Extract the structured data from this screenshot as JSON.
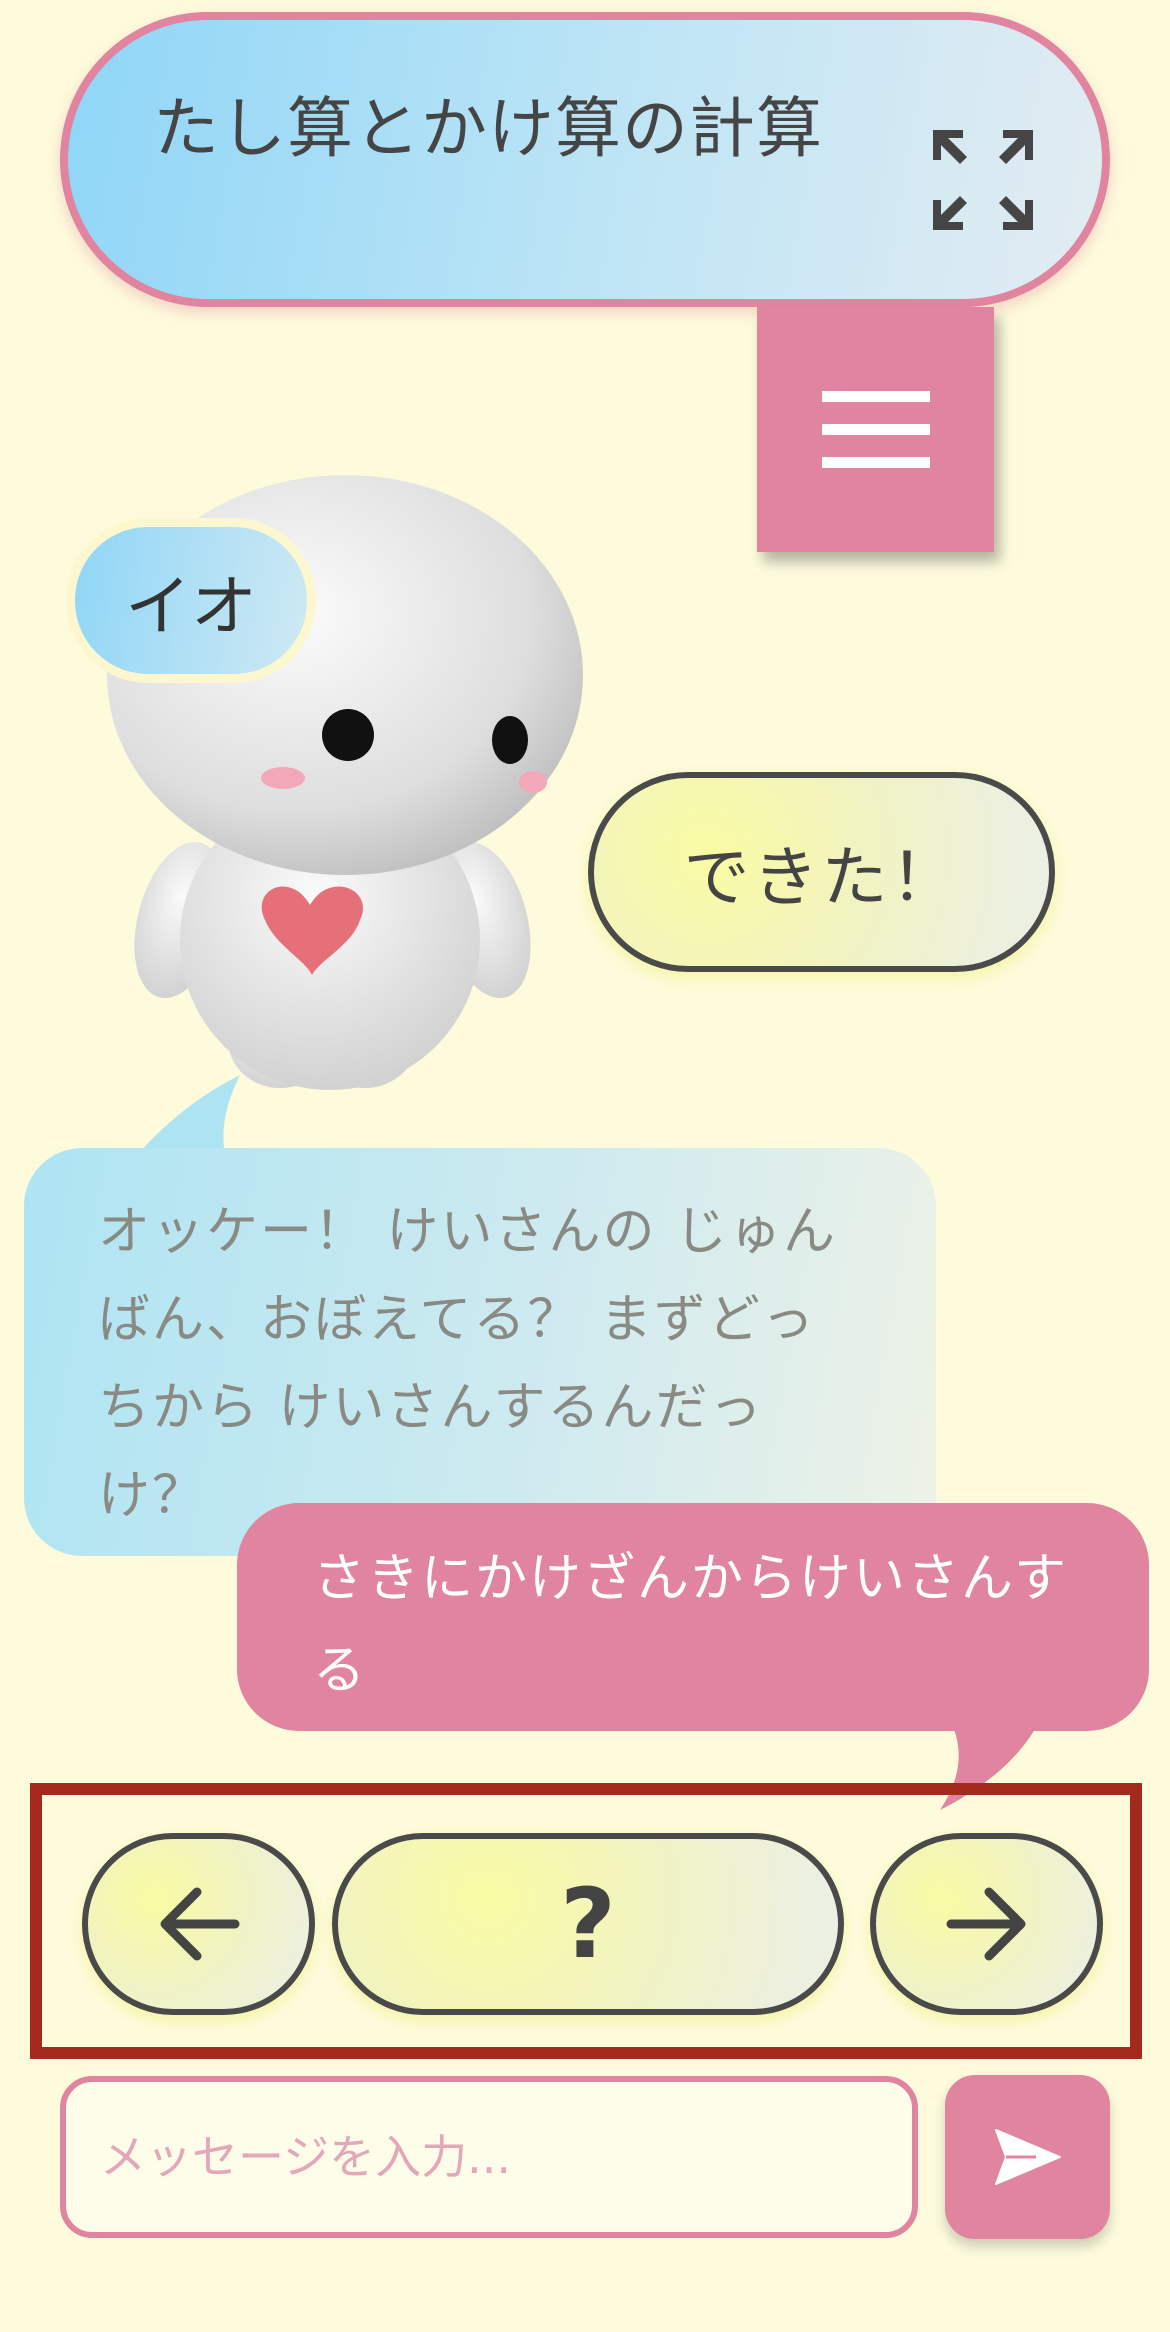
{
  "header": {
    "title": "たし算とかけ算の計算",
    "fullscreen_icon": "expand-arrows-icon"
  },
  "menu": {
    "icon": "hamburger-icon"
  },
  "character": {
    "name": "イオ"
  },
  "suggestion": {
    "label": "できた！"
  },
  "chat": {
    "ai_message": "オッケー！ けいさんの じゅんばん、おぼえてる？ まずどっちから けいさんするんだっけ？",
    "user_message": "さきにかけざんからけいさんする"
  },
  "navigation": {
    "prev_icon": "arrow-left-icon",
    "help_label": "?",
    "next_icon": "arrow-right-icon"
  },
  "composer": {
    "placeholder": "メッセージを入力...",
    "value": "",
    "send_icon": "send-icon"
  },
  "colors": {
    "background": "#fdfbdc",
    "accent_pink": "#e0849f",
    "accent_blue": "#8fd6f7",
    "highlight_border": "#a42a1e"
  }
}
